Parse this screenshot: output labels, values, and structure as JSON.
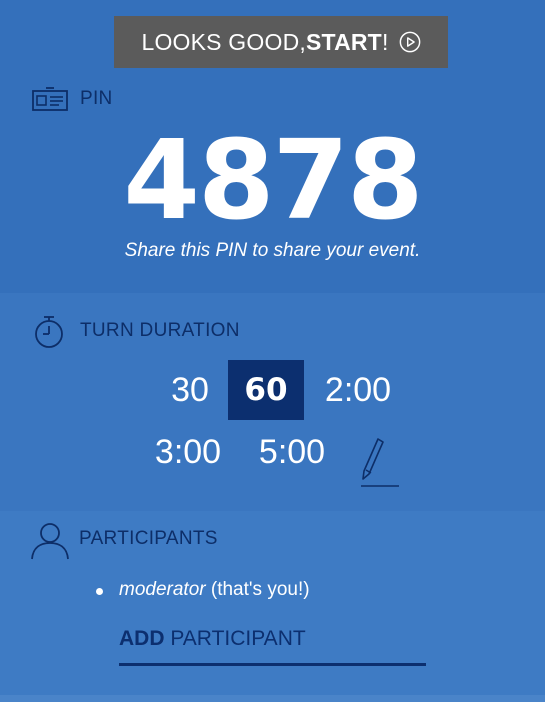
{
  "start_button": {
    "prefix": "LOOKS GOOD, ",
    "bold": "START",
    "suffix": "!",
    "icon": "play-circle-icon"
  },
  "pin": {
    "label": "PIN",
    "value": "4878",
    "hint": "Share this PIN to share your event.",
    "icon": "id-card-icon"
  },
  "turn_duration": {
    "label": "TURN DURATION",
    "icon": "stopwatch-icon",
    "options": [
      "30",
      "60",
      "2:00",
      "3:00",
      "5:00"
    ],
    "selected": "60",
    "edit_icon": "pencil-icon"
  },
  "participants": {
    "label": "PARTICIPANTS",
    "icon": "person-icon",
    "items": [
      {
        "name": "moderator",
        "note": " (that's you!)"
      }
    ],
    "add_bold": "ADD",
    "add_rest": " PARTICIPANT"
  },
  "colors": {
    "background": "#3470bb",
    "selected": "#0c2f6f",
    "label": "#0d2e68",
    "button": "#5b5b5b"
  }
}
